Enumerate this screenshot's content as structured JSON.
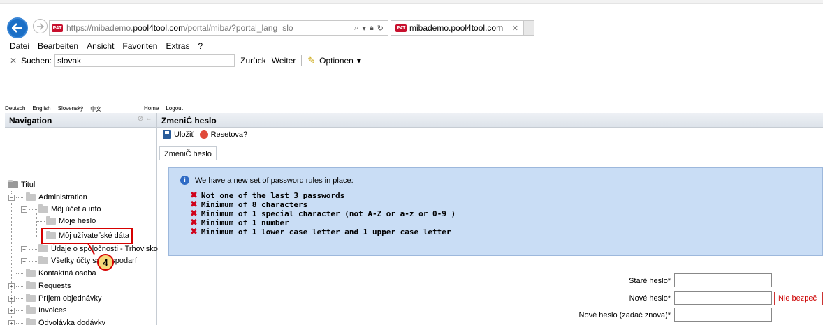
{
  "browser": {
    "url_prefix": "https://mibademo.",
    "url_domain": "pool4tool.com",
    "url_suffix": "/portal/miba/?portal_lang=slo",
    "site_logo": "P4T",
    "tab_title": "mibademo.pool4tool.com",
    "menu": [
      "Datei",
      "Bearbeiten",
      "Ansicht",
      "Favoriten",
      "Extras",
      "?"
    ],
    "find": {
      "label": "Suchen:",
      "value": "slovak",
      "back": "Zurück",
      "next": "Weiter",
      "options": "Optionen"
    }
  },
  "portal": {
    "languages": [
      "Deutsch",
      "English",
      "Slovenský",
      "中文"
    ],
    "links": [
      "Home",
      "Logout"
    ],
    "nav_title": "Navigation",
    "tree": {
      "root": "Titul",
      "administration": "Administration",
      "account": "Môj účet a info",
      "my_password": "Moje heslo",
      "my_user_data": "Môj užívateľské dáta",
      "company_data": "Údaje o spoločnosti - Trhovisko",
      "all_accounts": "Všetky účty sa hospodarí",
      "contact": "Kontaktná osoba",
      "requests": "Requests",
      "orders": "Príjem objednávky",
      "invoices": "Invoices",
      "delivery": "Odvolávka dodávky"
    },
    "callout_number": "4",
    "main_title": "ZmeniČ heslo",
    "toolbar": {
      "save": "Uložiť",
      "reset": "Resetova?"
    },
    "tab": "ZmeniČ heslo",
    "info": {
      "heading": "We have a new set of password rules in place:",
      "rules": [
        "Not one of the last 3 passwords",
        "Minimum of 8 characters",
        "Minimum of 1 special character (not A-Z or a-z or 0-9 )",
        "Minimum of 1 number",
        "Minimum of 1 lower case letter and 1 upper case letter"
      ]
    },
    "form": {
      "old_password": "Staré heslo*",
      "new_password": "Nové heslo*",
      "repeat_password": "Nové heslo (zadač znova)*",
      "strength_warning": "Nie bezpeč"
    }
  }
}
